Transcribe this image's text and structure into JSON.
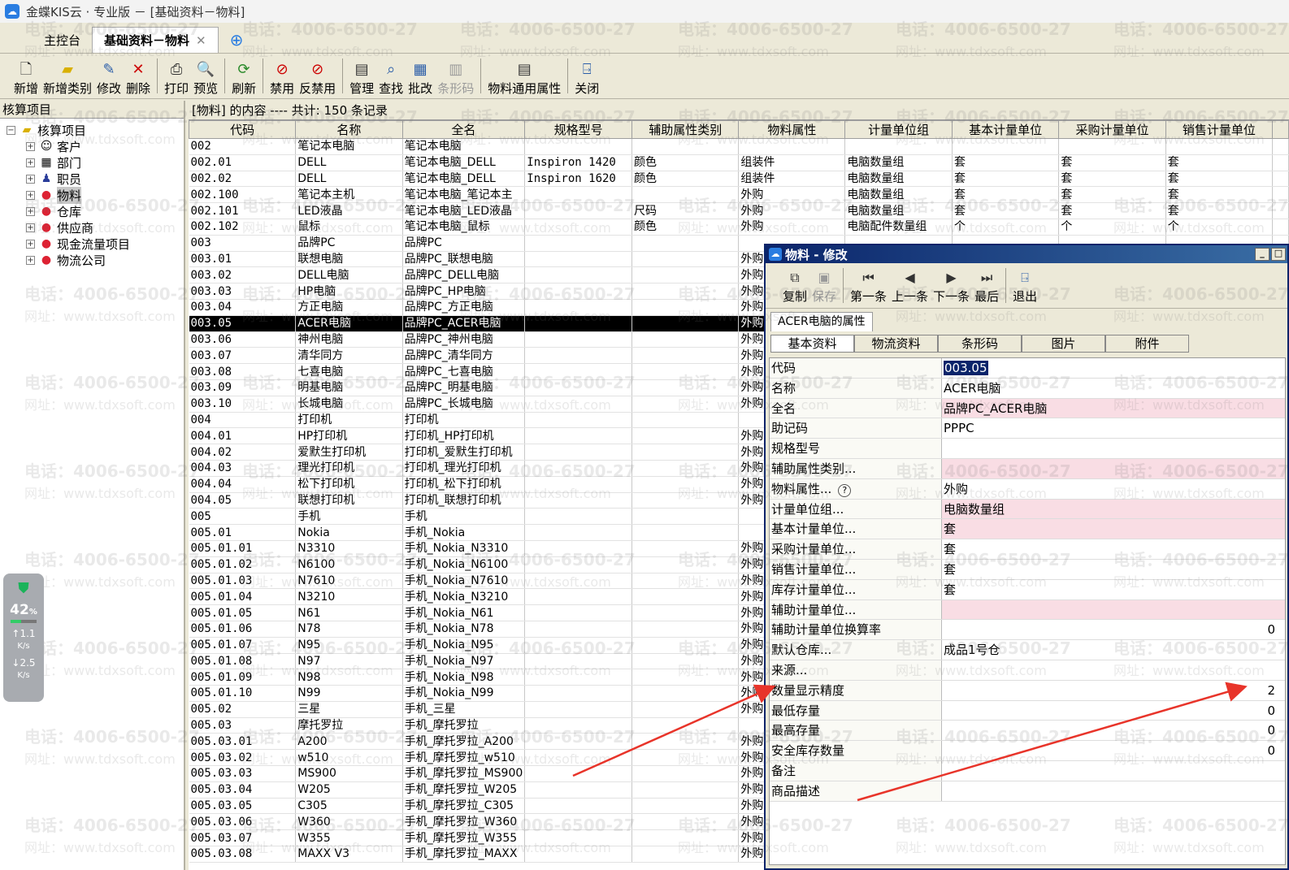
{
  "window": {
    "title": "金蝶KIS云 · 专业版 － [基础资料－物料]"
  },
  "tabs": [
    {
      "label": "主控台"
    },
    {
      "label": "基础资料－物料"
    }
  ],
  "toolbar": [
    "新增",
    "新增类别",
    "修改",
    "删除",
    "打印",
    "预览",
    "刷新",
    "禁用",
    "反禁用",
    "管理",
    "查找",
    "批改",
    "条形码",
    "物料通用属性",
    "关闭"
  ],
  "tree": {
    "title": "核算项目",
    "root": "核算项目",
    "items": [
      "客户",
      "部门",
      "职员",
      "物料",
      "仓库",
      "供应商",
      "现金流量项目",
      "物流公司"
    ]
  },
  "list": {
    "header": "[物料] 的内容 ---- 共计: 150 条记录",
    "columns": [
      "代码",
      "名称",
      "全名",
      "规格型号",
      "辅助属性类别",
      "物料属性",
      "计量单位组",
      "基本计量单位",
      "采购计量单位",
      "销售计量单位"
    ],
    "rows": [
      [
        "002",
        "笔记本电脑",
        "笔记本电脑",
        "",
        "",
        "",
        "",
        "",
        "",
        ""
      ],
      [
        "002.01",
        "DELL",
        "笔记本电脑_DELL",
        "Inspiron 1420",
        "颜色",
        "组装件",
        "电脑数量组",
        "套",
        "套",
        "套"
      ],
      [
        "002.02",
        "DELL",
        "笔记本电脑_DELL",
        "Inspiron 1620",
        "颜色",
        "组装件",
        "电脑数量组",
        "套",
        "套",
        "套"
      ],
      [
        "002.100",
        "笔记本主机",
        "笔记本电脑_笔记本主",
        "",
        "",
        "外购",
        "电脑数量组",
        "套",
        "套",
        "套"
      ],
      [
        "002.101",
        "LED液晶",
        "笔记本电脑_LED液晶",
        "",
        "尺码",
        "外购",
        "电脑数量组",
        "套",
        "套",
        "套"
      ],
      [
        "002.102",
        "鼠标",
        "笔记本电脑_鼠标",
        "",
        "颜色",
        "外购",
        "电脑配件数量组",
        "个",
        "个",
        "个"
      ],
      [
        "003",
        "品牌PC",
        "品牌PC",
        "",
        "",
        "",
        "",
        "",
        "",
        ""
      ],
      [
        "003.01",
        "联想电脑",
        "品牌PC_联想电脑",
        "",
        "",
        "外购",
        "",
        "",
        "",
        ""
      ],
      [
        "003.02",
        "DELL电脑",
        "品牌PC_DELL电脑",
        "",
        "",
        "外购",
        "",
        "",
        "",
        ""
      ],
      [
        "003.03",
        "HP电脑",
        "品牌PC_HP电脑",
        "",
        "",
        "外购",
        "",
        "",
        "",
        ""
      ],
      [
        "003.04",
        "方正电脑",
        "品牌PC_方正电脑",
        "",
        "",
        "外购",
        "",
        "",
        "",
        ""
      ],
      [
        "003.05",
        "ACER电脑",
        "品牌PC_ACER电脑",
        "",
        "",
        "外购",
        "",
        "",
        "",
        ""
      ],
      [
        "003.06",
        "神州电脑",
        "品牌PC_神州电脑",
        "",
        "",
        "外购",
        "",
        "",
        "",
        ""
      ],
      [
        "003.07",
        "清华同方",
        "品牌PC_清华同方",
        "",
        "",
        "外购",
        "",
        "",
        "",
        ""
      ],
      [
        "003.08",
        "七喜电脑",
        "品牌PC_七喜电脑",
        "",
        "",
        "外购",
        "",
        "",
        "",
        ""
      ],
      [
        "003.09",
        "明基电脑",
        "品牌PC_明基电脑",
        "",
        "",
        "外购",
        "",
        "",
        "",
        ""
      ],
      [
        "003.10",
        "长城电脑",
        "品牌PC_长城电脑",
        "",
        "",
        "外购",
        "",
        "",
        "",
        ""
      ],
      [
        "004",
        "打印机",
        "打印机",
        "",
        "",
        "",
        "",
        "",
        "",
        ""
      ],
      [
        "004.01",
        "HP打印机",
        "打印机_HP打印机",
        "",
        "",
        "外购",
        "",
        "",
        "",
        ""
      ],
      [
        "004.02",
        "爱默生打印机",
        "打印机_爱默生打印机",
        "",
        "",
        "外购",
        "",
        "",
        "",
        ""
      ],
      [
        "004.03",
        "理光打印机",
        "打印机_理光打印机",
        "",
        "",
        "外购",
        "",
        "",
        "",
        ""
      ],
      [
        "004.04",
        "松下打印机",
        "打印机_松下打印机",
        "",
        "",
        "外购",
        "",
        "",
        "",
        ""
      ],
      [
        "004.05",
        "联想打印机",
        "打印机_联想打印机",
        "",
        "",
        "外购",
        "",
        "",
        "",
        ""
      ],
      [
        "005",
        "手机",
        "手机",
        "",
        "",
        "",
        "",
        "",
        "",
        ""
      ],
      [
        "005.01",
        "Nokia",
        "手机_Nokia",
        "",
        "",
        "",
        "",
        "",
        "",
        ""
      ],
      [
        "005.01.01",
        "N3310",
        "手机_Nokia_N3310",
        "",
        "",
        "外购",
        "",
        "",
        "",
        ""
      ],
      [
        "005.01.02",
        "N6100",
        "手机_Nokia_N6100",
        "",
        "",
        "外购",
        "",
        "",
        "",
        ""
      ],
      [
        "005.01.03",
        "N7610",
        "手机_Nokia_N7610",
        "",
        "",
        "外购",
        "",
        "",
        "",
        ""
      ],
      [
        "005.01.04",
        "N3210",
        "手机_Nokia_N3210",
        "",
        "",
        "外购",
        "",
        "",
        "",
        ""
      ],
      [
        "005.01.05",
        "N61",
        "手机_Nokia_N61",
        "",
        "",
        "外购",
        "",
        "",
        "",
        ""
      ],
      [
        "005.01.06",
        "N78",
        "手机_Nokia_N78",
        "",
        "",
        "外购",
        "",
        "",
        "",
        ""
      ],
      [
        "005.01.07",
        "N95",
        "手机_Nokia_N95",
        "",
        "",
        "外购",
        "",
        "",
        "",
        ""
      ],
      [
        "005.01.08",
        "N97",
        "手机_Nokia_N97",
        "",
        "",
        "外购",
        "",
        "",
        "",
        ""
      ],
      [
        "005.01.09",
        "N98",
        "手机_Nokia_N98",
        "",
        "",
        "外购",
        "",
        "",
        "",
        ""
      ],
      [
        "005.01.10",
        "N99",
        "手机_Nokia_N99",
        "",
        "",
        "外购",
        "",
        "",
        "",
        ""
      ],
      [
        "005.02",
        "三星",
        "手机_三星",
        "",
        "",
        "外购",
        "",
        "",
        "",
        ""
      ],
      [
        "005.03",
        "摩托罗拉",
        "手机_摩托罗拉",
        "",
        "",
        "",
        "",
        "",
        "",
        ""
      ],
      [
        "005.03.01",
        "A200",
        "手机_摩托罗拉_A200",
        "",
        "",
        "外购",
        "",
        "",
        "",
        ""
      ],
      [
        "005.03.02",
        "w510",
        "手机_摩托罗拉_w510",
        "",
        "",
        "外购",
        "",
        "",
        "",
        ""
      ],
      [
        "005.03.03",
        "MS900",
        "手机_摩托罗拉_MS900",
        "",
        "",
        "外购",
        "",
        "",
        "",
        ""
      ],
      [
        "005.03.04",
        "W205",
        "手机_摩托罗拉_W205",
        "",
        "",
        "外购",
        "",
        "",
        "",
        ""
      ],
      [
        "005.03.05",
        "C305",
        "手机_摩托罗拉_C305",
        "",
        "",
        "外购",
        "",
        "",
        "",
        ""
      ],
      [
        "005.03.06",
        "W360",
        "手机_摩托罗拉_W360",
        "",
        "",
        "外购",
        "",
        "",
        "",
        ""
      ],
      [
        "005.03.07",
        "W355",
        "手机_摩托罗拉_W355",
        "",
        "",
        "外购",
        "",
        "",
        "",
        ""
      ],
      [
        "005.03.08",
        "MAXX V3",
        "手机_摩托罗拉_MAXX",
        "",
        "",
        "外购",
        "",
        "",
        "",
        ""
      ]
    ],
    "selected_code": "003.05"
  },
  "dialog": {
    "title": "物料 - 修改",
    "toolbar": [
      "复制",
      "保存",
      "第一条",
      "上一条",
      "下一条",
      "最后",
      "退出"
    ],
    "section_tab": "ACER电脑的属性",
    "subtabs": [
      "基本资料",
      "物流资料",
      "条形码",
      "图片",
      "附件"
    ],
    "fields": [
      {
        "label": "代码",
        "value": "003.05",
        "highlight": true
      },
      {
        "label": "名称",
        "value": "ACER电脑"
      },
      {
        "label": "全名",
        "value": "品牌PC_ACER电脑",
        "required": true
      },
      {
        "label": "助记码",
        "value": "PPPC"
      },
      {
        "label": "规格型号",
        "value": ""
      },
      {
        "label": "辅助属性类别...",
        "value": "",
        "required": true
      },
      {
        "label": "物料属性...",
        "value": "外购",
        "help": true
      },
      {
        "label": "计量单位组...",
        "value": "电脑数量组",
        "required": true
      },
      {
        "label": "基本计量单位...",
        "value": "套",
        "required": true
      },
      {
        "label": "采购计量单位...",
        "value": "套"
      },
      {
        "label": "销售计量单位...",
        "value": "套"
      },
      {
        "label": "库存计量单位...",
        "value": "套"
      },
      {
        "label": "辅助计量单位...",
        "value": "",
        "required": true
      },
      {
        "label": "辅助计量单位换算率",
        "value": "0",
        "numeric": true
      },
      {
        "label": "默认仓库...",
        "value": "成品1号仓"
      },
      {
        "label": "来源...",
        "value": ""
      },
      {
        "label": "数量显示精度",
        "value": "2",
        "numeric": true
      },
      {
        "label": "最低存量",
        "value": "0",
        "numeric": true
      },
      {
        "label": "最高存量",
        "value": "0",
        "numeric": true
      },
      {
        "label": "安全库存数量",
        "value": "0",
        "numeric": true
      },
      {
        "label": "备注",
        "value": ""
      },
      {
        "label": "商品描述",
        "value": ""
      }
    ]
  },
  "monitor": {
    "cpu_percent": "42",
    "cpu_unit": "%",
    "up_speed": "1.1",
    "down_speed": "2.5",
    "speed_unit": "K/s"
  },
  "watermark": {
    "phone": "电话：4006-6500-27",
    "site": "网址：www.tdxsoft.com"
  },
  "colors": {
    "selection": "#000000",
    "required_field": "#f9dde4",
    "dialog_title": "#0a246a",
    "arrow": "#e8342a"
  }
}
